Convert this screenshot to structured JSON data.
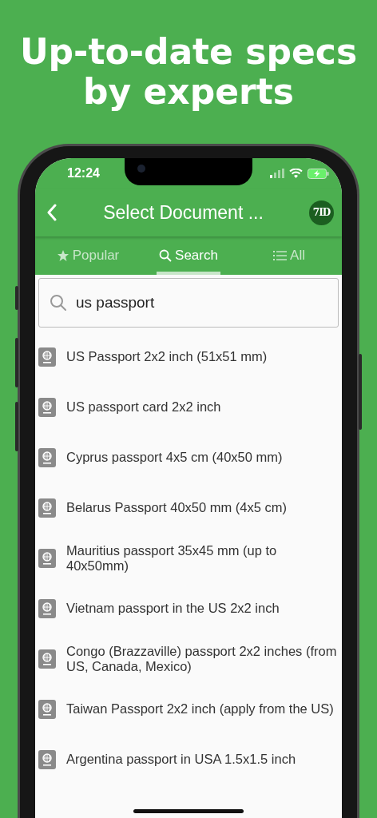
{
  "headline": "Up-to-date specs by experts",
  "status_bar": {
    "time": "12:24"
  },
  "nav_bar": {
    "title": "Select Document ...",
    "logo": "7ID"
  },
  "tabs": [
    {
      "label": "Popular",
      "selected": false
    },
    {
      "label": "Search",
      "selected": true
    },
    {
      "label": "All",
      "selected": false
    }
  ],
  "search": {
    "value": "us passport"
  },
  "results": [
    {
      "label": "US Passport 2x2 inch (51x51 mm)"
    },
    {
      "label": "US passport card 2x2 inch"
    },
    {
      "label": "Cyprus passport 4x5 cm (40x50 mm)"
    },
    {
      "label": "Belarus Passport 40x50 mm (4x5 cm)"
    },
    {
      "label": "Mauritius passport 35x45 mm (up to 40x50mm)"
    },
    {
      "label": "Vietnam passport in the US 2x2 inch"
    },
    {
      "label": "Congo (Brazzaville) passport 2x2 inches (from US, Canada, Mexico)"
    },
    {
      "label": "Taiwan Passport 2x2 inch (apply from the US)"
    },
    {
      "label": "Argentina passport in USA 1.5x1.5 inch"
    }
  ]
}
